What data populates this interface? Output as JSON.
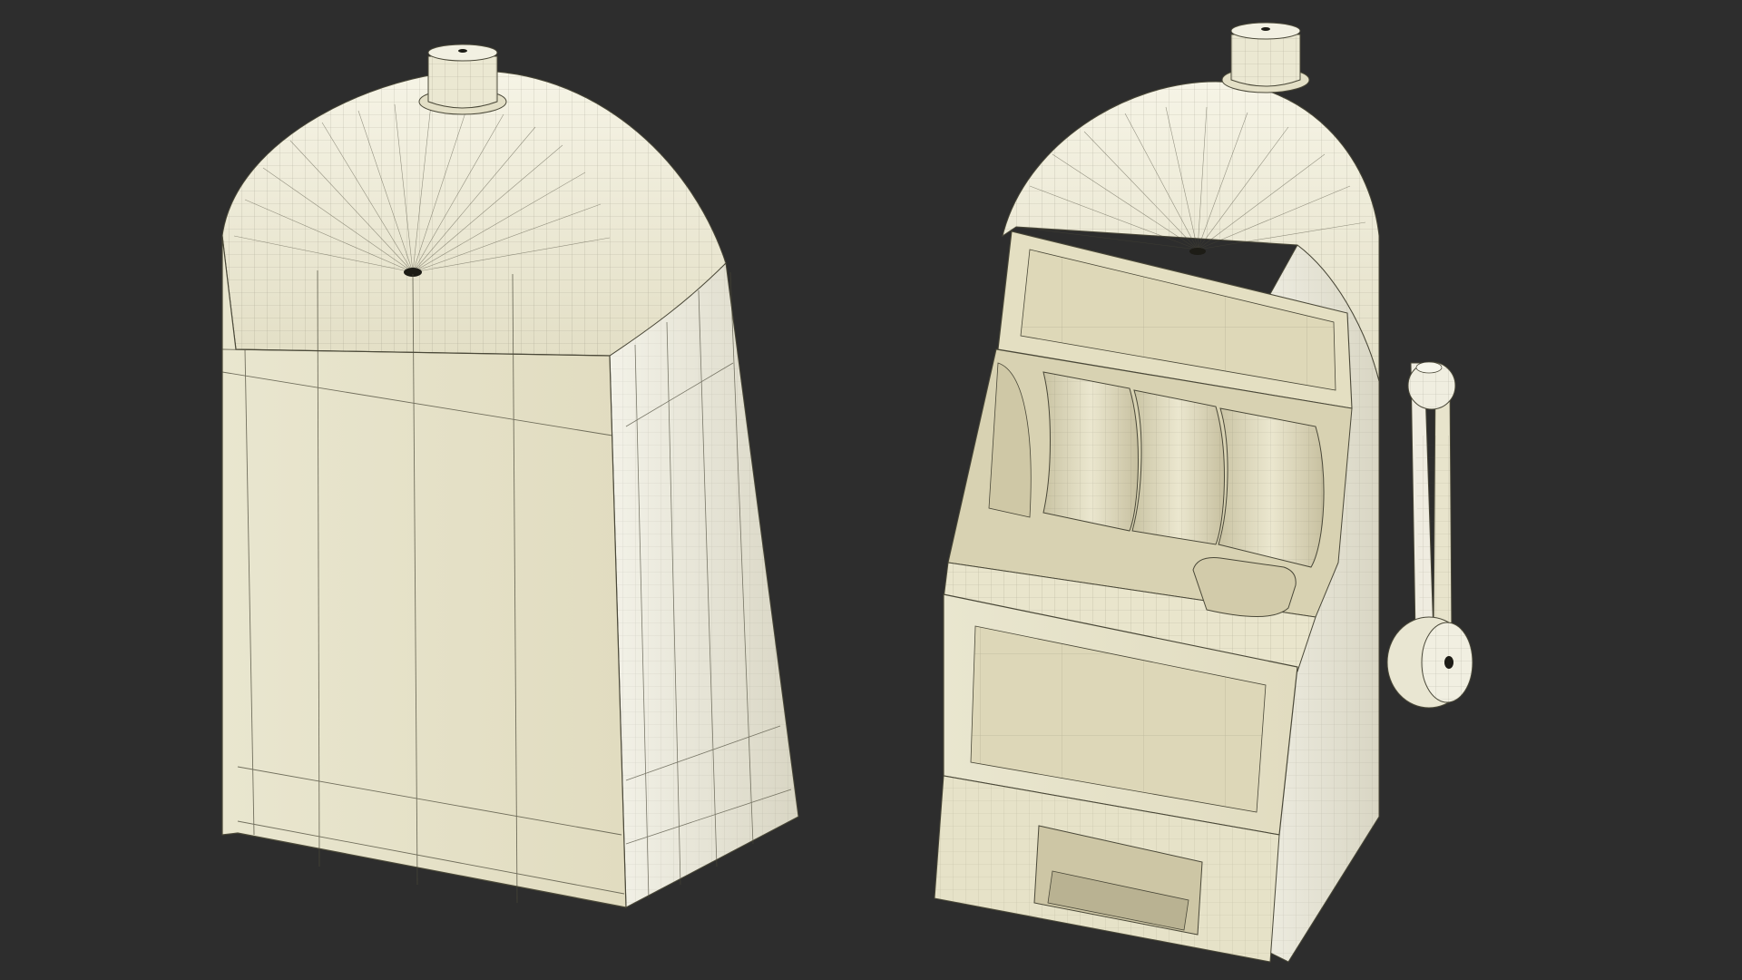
{
  "scene": {
    "background": "#2d2d2d",
    "model_colors": {
      "shell_light": "#efeee0",
      "shell_mid": "#e3dfc4",
      "shell_dark": "#cfc9aa",
      "wire": "#4a4838"
    },
    "objects": [
      {
        "name": "slot-machine-back-view",
        "view": "back"
      },
      {
        "name": "slot-machine-front-view",
        "view": "front"
      }
    ]
  }
}
